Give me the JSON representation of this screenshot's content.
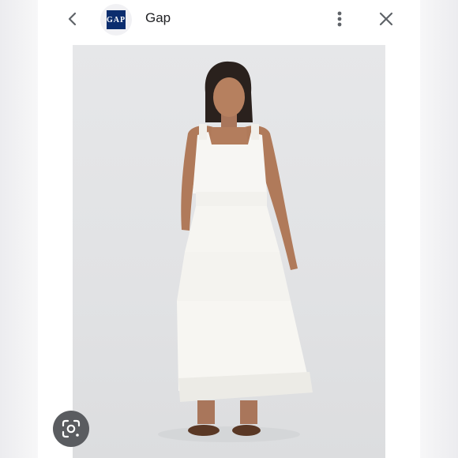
{
  "header": {
    "title": "Gap",
    "logo_text": "GAP"
  },
  "icons": {
    "back": "chevron-left-icon",
    "more": "more-vert-icon",
    "close": "close-icon",
    "lens": "google-lens-icon"
  },
  "colors": {
    "brand": "#0b2d6e",
    "background": "#e3e4e6",
    "lens_button": "#5a5c60"
  }
}
